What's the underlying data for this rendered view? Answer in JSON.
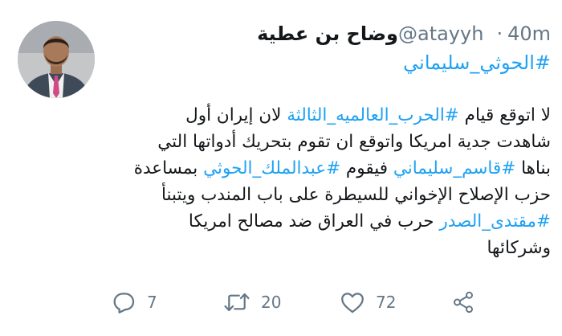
{
  "author": {
    "display_name": "وضاح بن عطية",
    "handle": "@atayyh",
    "separator": "·",
    "time": "40m"
  },
  "tag_line": "#الحوثي_سليماني",
  "body": {
    "line1": {
      "t1": "لا اتوقع قيام ",
      "h1": "#الحرب_العالميه_الثالثة",
      "t2": " لان إيران أول"
    },
    "line2": {
      "t1": "شاهدت جدية امريكا واتوقع ان تقوم بتحريك أدواتها التي"
    },
    "line3": {
      "t1": "بناها ",
      "h1": "#قاسم_سليماني",
      "t2": " فيقوم ",
      "h2": "#عبدالملك_الحوثي",
      "t3": " بمساعدة"
    },
    "line4": {
      "t1": "حزب الإصلاح الإخواني للسيطرة على باب المندب ويتبنأ"
    },
    "line5": {
      "h1": "#مقتدى_الصدر",
      "t1": " حرب في العراق ضد مصالح امريكا"
    },
    "line6": {
      "t1": "وشركائها"
    }
  },
  "actions": {
    "reply_count": "7",
    "retweet_count": "20",
    "like_count": "72"
  },
  "colors": {
    "link": "#1da1f2",
    "text": "#14171a",
    "muted": "#657786"
  },
  "icons": [
    "reply-icon",
    "retweet-icon",
    "like-icon",
    "share-icon"
  ]
}
